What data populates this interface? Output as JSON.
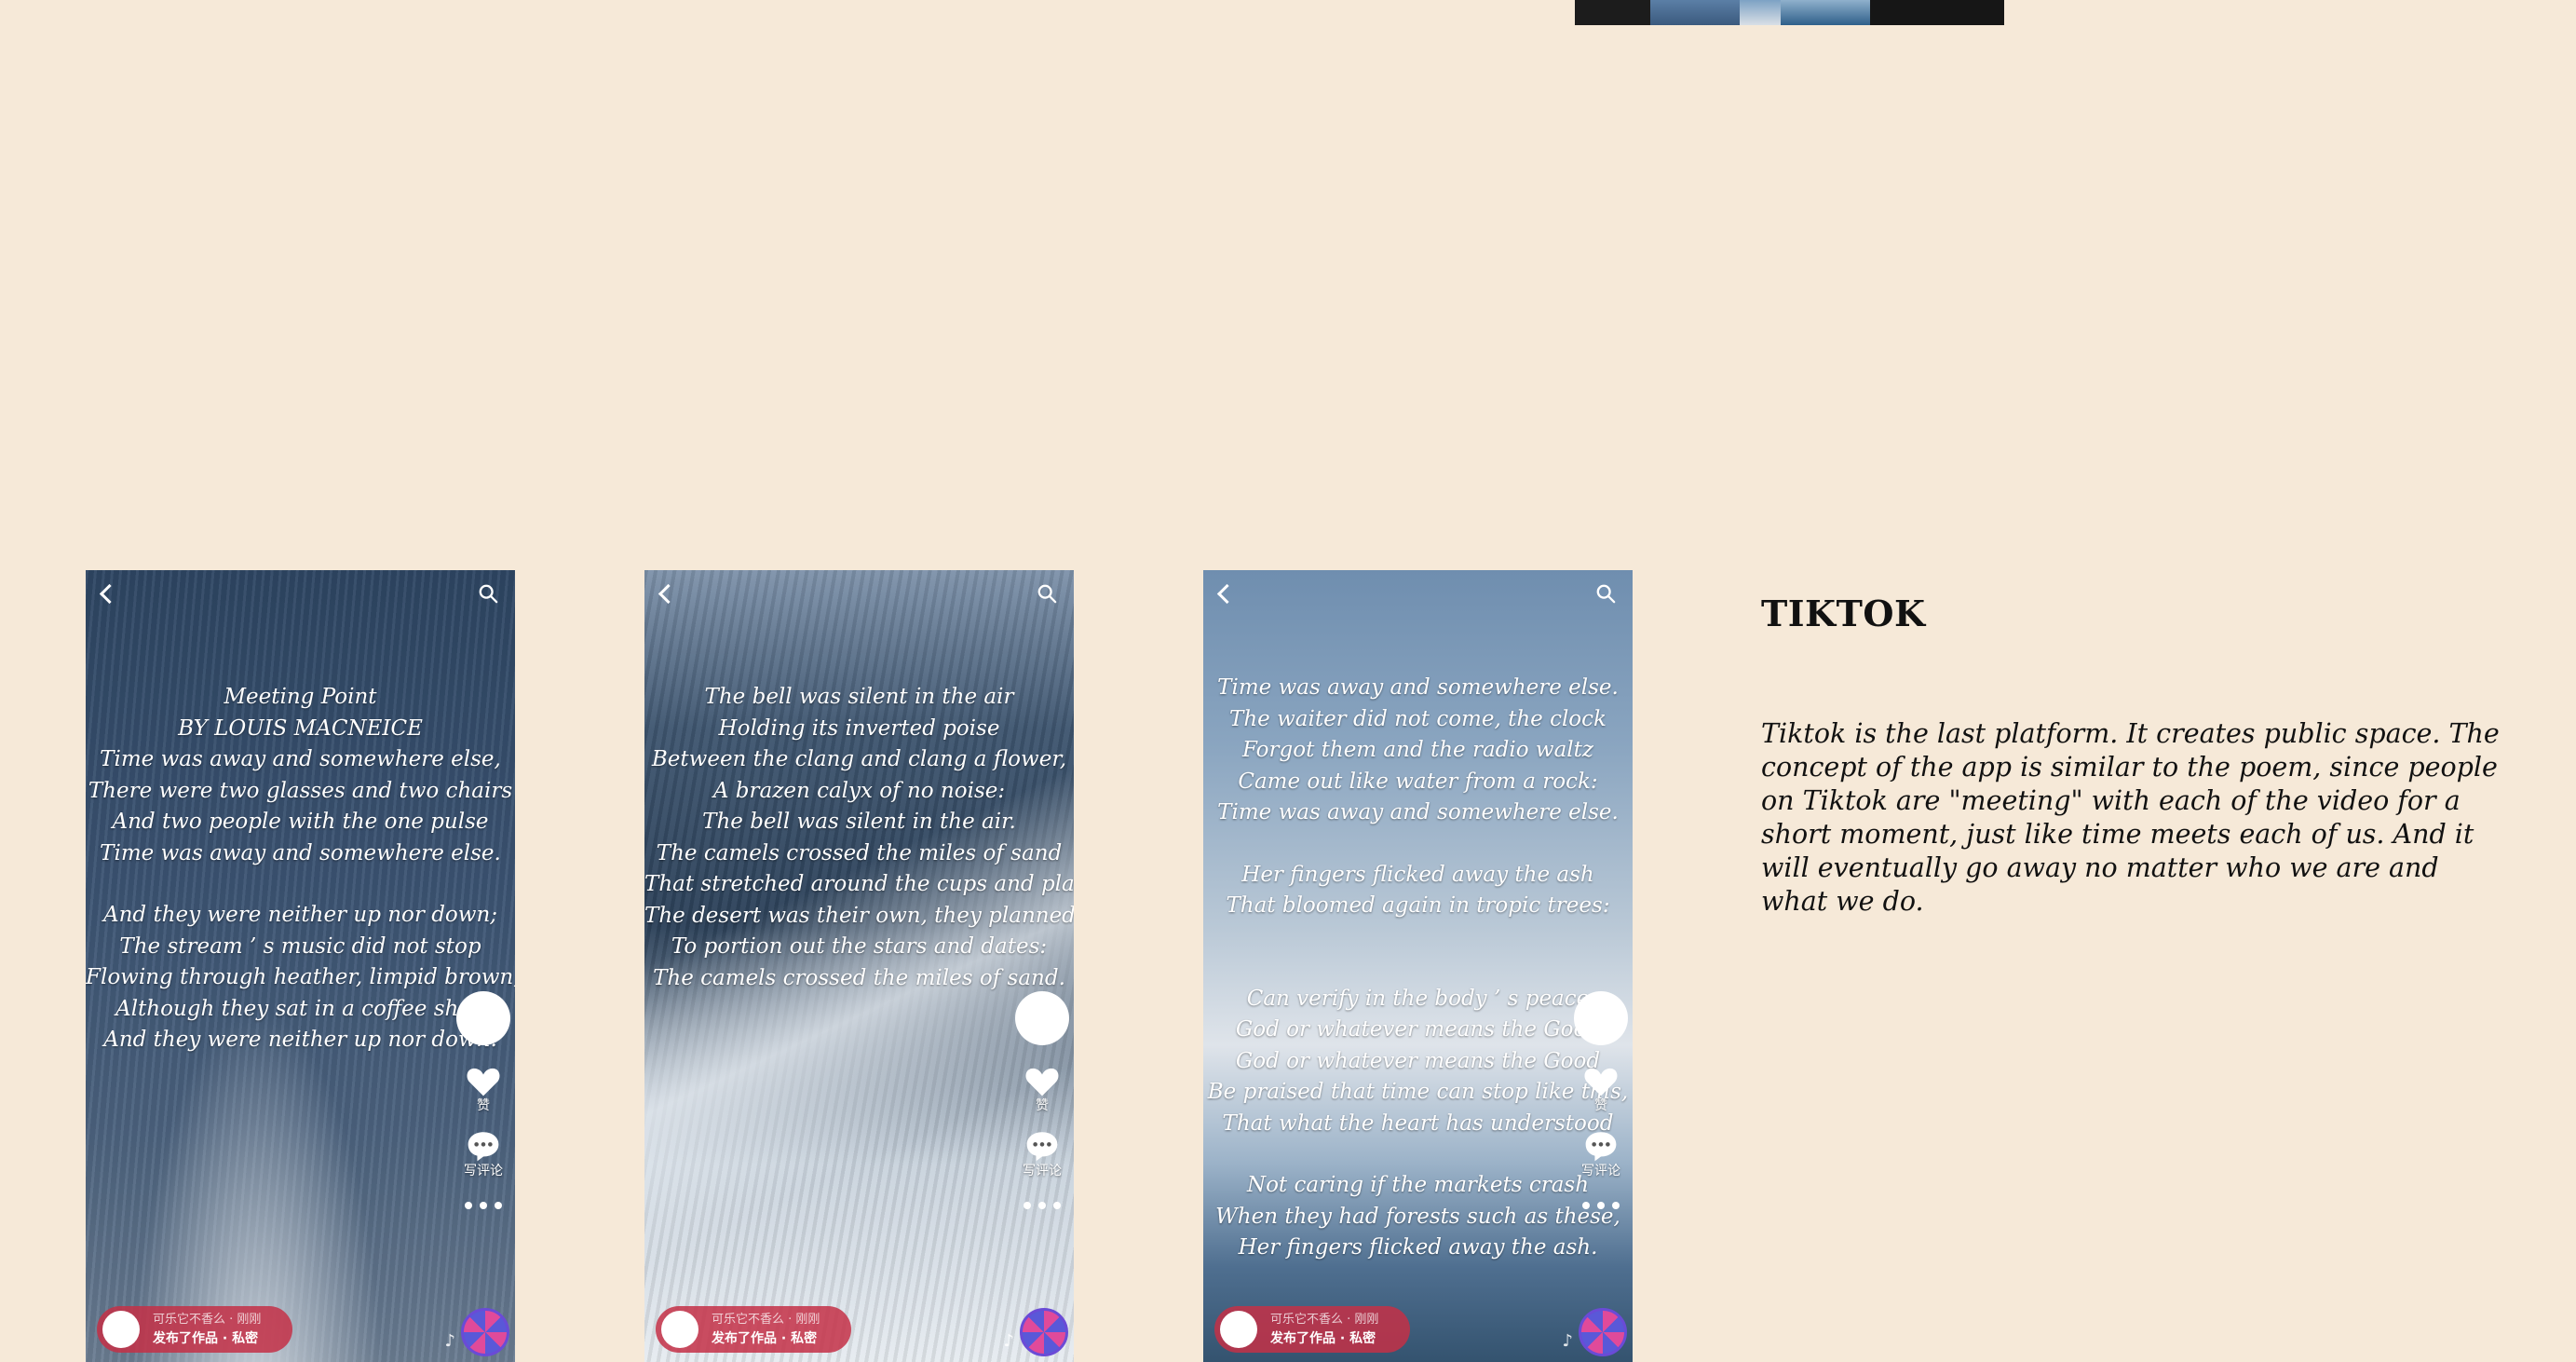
{
  "section": {
    "title": "TIKTOK",
    "body": "Tiktok is the last platform. It creates public space. The concept of the app is similar to the poem, since people on Tiktok are \"meeting\" with each of the video for a short moment, just like time meets each of us. And it will eventually go away no matter who we are and what we do."
  },
  "phones": [
    {
      "lines": [
        "Meeting Point",
        "BY LOUIS MACNEICE",
        "Time was away and somewhere else,",
        "There were two glasses and two chairs",
        "And two people with the one pulse",
        "Time was away and somewhere else.",
        "",
        "And they were neither up nor down;",
        "The stream ’ s music did not stop",
        "Flowing through heather, limpid brown,",
        "Although they sat in a coffee shop",
        "And they were neither up nor down."
      ],
      "like_label": "赞",
      "comment_label": "写评论",
      "bottom_line1": "可乐它不香么 · 刚刚",
      "bottom_line2": "发布了作品 · 私密"
    },
    {
      "lines": [
        "The bell was silent in the air",
        "Holding its inverted poise",
        "Between the clang and clang a flower,",
        "A brazen calyx of no noise:",
        "The bell was silent in the air.",
        "The camels crossed the miles of sand",
        "That stretched around the cups and plates;",
        "The desert was their own, they planned",
        "To portion out the stars and dates:",
        "The camels crossed the miles of sand."
      ],
      "like_label": "赞",
      "comment_label": "写评论",
      "bottom_line1": "可乐它不香么 · 刚刚",
      "bottom_line2": "发布了作品 · 私密"
    },
    {
      "lines": [
        "Time was away and somewhere else.",
        "The waiter did not come, the clock",
        "Forgot them and the radio waltz",
        "Came out like water from a rock:",
        "Time was away and somewhere else.",
        "",
        "Her fingers flicked away the ash",
        "That bloomed again in tropic trees:",
        "",
        "",
        "Can verify in the body ’ s peace",
        "God or whatever means the Good",
        "God or whatever means the Good",
        "Be praised that time can stop like this,",
        "That what the heart has understood",
        "",
        "Not caring if the markets crash",
        "When they had forests such as these,",
        "Her fingers flicked away the ash."
      ],
      "like_label": "赞",
      "comment_label": "写评论",
      "bottom_line1": "可乐它不香么 · 刚刚",
      "bottom_line2": "发布了作品 · 私密"
    }
  ],
  "icons": {
    "back": "chevron-left-icon",
    "search": "search-icon",
    "like": "heart-icon",
    "comment": "comment-icon",
    "more": "more-dots-icon",
    "music_note": "music-note-icon",
    "music_disc": "music-disc-icon"
  },
  "colors": {
    "background": "#f6e9d8",
    "accent": "#c43046"
  }
}
